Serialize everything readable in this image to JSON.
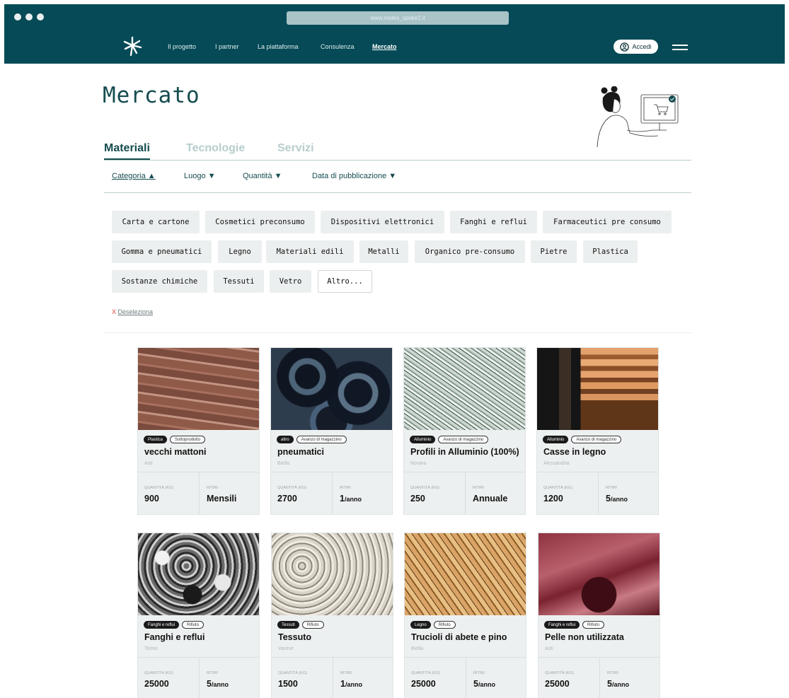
{
  "topbar": {
    "url": "www.nodes_spoke2.it",
    "nav": [
      "Il progetto",
      "I partner",
      "La piattaforma",
      "Consulenza",
      "Mercato"
    ],
    "login_label": "Accedi",
    "colors": {
      "bar": "#054a56",
      "accent": "#154c4f"
    }
  },
  "page": {
    "title": "Mercato",
    "tabs": [
      "Materiali",
      "Tecnologie",
      "Servizi"
    ],
    "filters": [
      "Categoria ▲",
      "Luogo ▼",
      "Quantità ▼",
      "Data di pubblicazione ▼"
    ]
  },
  "chips": [
    "Carta e cartone",
    "Cosmetici preconsumo",
    "Dispositivi elettronici",
    "Fanghi e reflui",
    "Farmaceutici pre consumo",
    "Gomma e pneumatici",
    "Legno",
    "Materiali edili",
    "Metalli",
    "Organico pre-consumo",
    "Pietre",
    "Plastica",
    "Sostanze chimiche",
    "Tessuti",
    "Vetro",
    "Altro..."
  ],
  "deselect": {
    "x": "X",
    "label": "Deseleziona"
  },
  "card_labels": {
    "quantity": "QUANTITÀ (KG)",
    "pickups": "RITIRI"
  },
  "cards": [
    {
      "badge1": "Plastica",
      "badge2": "Sottoprodotto",
      "title": "vecchi mattoni",
      "location": "Asti",
      "quantity": "900",
      "pickups": "Mensili",
      "unit": ""
    },
    {
      "badge1": "altro",
      "badge2": "Avanzo di magazzino",
      "title": "pneumatici",
      "location": "Biella",
      "quantity": "2700",
      "pickups": "1",
      "unit": "/anno"
    },
    {
      "badge1": "Alluminio",
      "badge2": "Avanzo di magazzino",
      "title": "Profili in Alluminio (100%)",
      "location": "Novara",
      "quantity": "250",
      "pickups": "Annuale",
      "unit": ""
    },
    {
      "badge1": "Alluminio",
      "badge2": "Avanzo di magazzino",
      "title": "Casse in legno",
      "location": "Alessandria",
      "quantity": "1200",
      "pickups": "5",
      "unit": "/anno"
    },
    {
      "badge1": "Fanghi e reflui",
      "badge2": "Rifiuto",
      "title": "Fanghi e reflui",
      "location": "Torino",
      "quantity": "25000",
      "pickups": "5",
      "unit": "/anno"
    },
    {
      "badge1": "Tessuti",
      "badge2": "Rifiuto",
      "title": "Tessuto",
      "location": "Varese",
      "quantity": "1500",
      "pickups": "1",
      "unit": "/anno"
    },
    {
      "badge1": "Legno",
      "badge2": "Rifiuto",
      "title": "Trucioli di abete e pino",
      "location": "Biella",
      "quantity": "25000",
      "pickups": "5",
      "unit": "/anno"
    },
    {
      "badge1": "Fanghi e reflui",
      "badge2": "Rifiuto",
      "title": "Pelle non utilizzata",
      "location": "Asti",
      "quantity": "25000",
      "pickups": "5",
      "unit": "/anno"
    }
  ]
}
